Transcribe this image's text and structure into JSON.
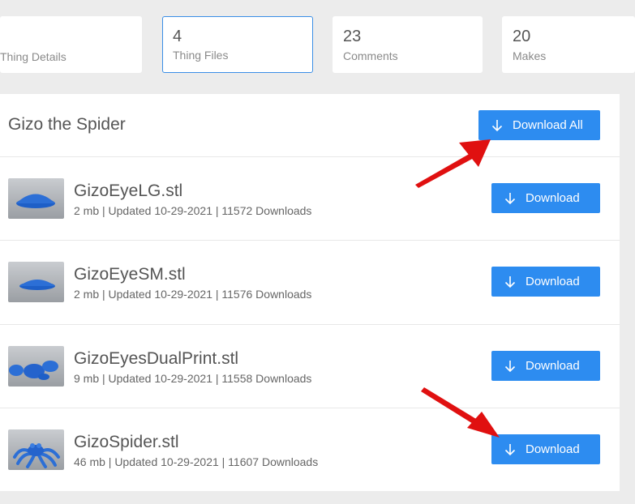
{
  "tabs": [
    {
      "num": "",
      "label": "Thing Details"
    },
    {
      "num": "4",
      "label": "Thing Files"
    },
    {
      "num": "23",
      "label": "Comments"
    },
    {
      "num": "20",
      "label": "Makes"
    }
  ],
  "panel": {
    "title": "Gizo the Spider",
    "download_all_label": "Download All"
  },
  "files": [
    {
      "name": "GizoEyeLG.stl",
      "meta": "2 mb | Updated 10-29-2021 | 11572 Downloads",
      "button": "Download"
    },
    {
      "name": "GizoEyeSM.stl",
      "meta": "2 mb | Updated 10-29-2021 | 11576 Downloads",
      "button": "Download"
    },
    {
      "name": "GizoEyesDualPrint.stl",
      "meta": "9 mb | Updated 10-29-2021 | 11558 Downloads",
      "button": "Download"
    },
    {
      "name": "GizoSpider.stl",
      "meta": "46 mb | Updated 10-29-2021 | 11607 Downloads",
      "button": "Download"
    }
  ],
  "colors": {
    "accent": "#2d8cf0",
    "arrow": "#e01010",
    "model": "#2c6fd6"
  },
  "icons": [
    "download-arrow-icon",
    "annotation-arrow"
  ]
}
